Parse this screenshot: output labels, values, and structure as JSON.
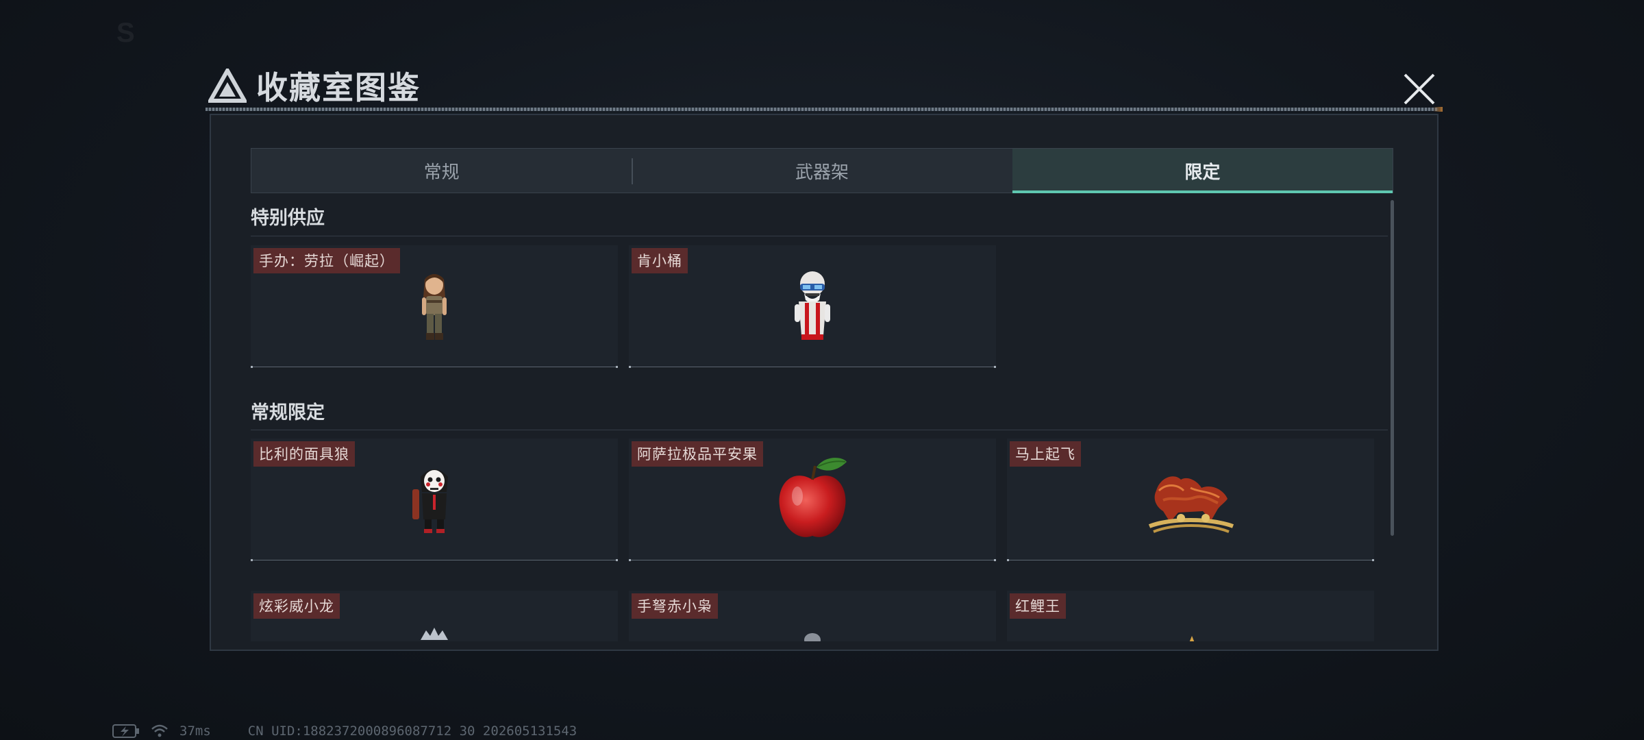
{
  "header": {
    "title": "收藏室图鉴"
  },
  "tabs": [
    {
      "label": "常规",
      "active": false
    },
    {
      "label": "武器架",
      "active": false
    },
    {
      "label": "限定",
      "active": true
    }
  ],
  "sections": [
    {
      "title": "特别供应",
      "items": [
        {
          "label": "手办：劳拉（崛起）",
          "icon": "lara-figure-icon"
        },
        {
          "label": "肯小桶",
          "icon": "kfc-figure-icon"
        }
      ]
    },
    {
      "title": "常规限定",
      "items": [
        {
          "label": "比利的面具狼",
          "icon": "jigsaw-puppet-icon"
        },
        {
          "label": "阿萨拉极品平安果",
          "icon": "red-apple-icon"
        },
        {
          "label": "马上起飞",
          "icon": "golden-horse-icon"
        },
        {
          "label": "炫彩威小龙",
          "icon": "dragon-figure-icon"
        },
        {
          "label": "手弩赤小枭",
          "icon": "owl-figure-icon"
        },
        {
          "label": "红鲤王",
          "icon": "koi-figure-icon"
        }
      ]
    }
  ],
  "status_bar": {
    "ping": "37ms",
    "uid": "CN UID:1882372000896087712 30  202605131543"
  },
  "colors": {
    "accent": "#5fc7b0",
    "label_bg": "#5a2b2c",
    "panel_bg": "#1a1f26"
  }
}
